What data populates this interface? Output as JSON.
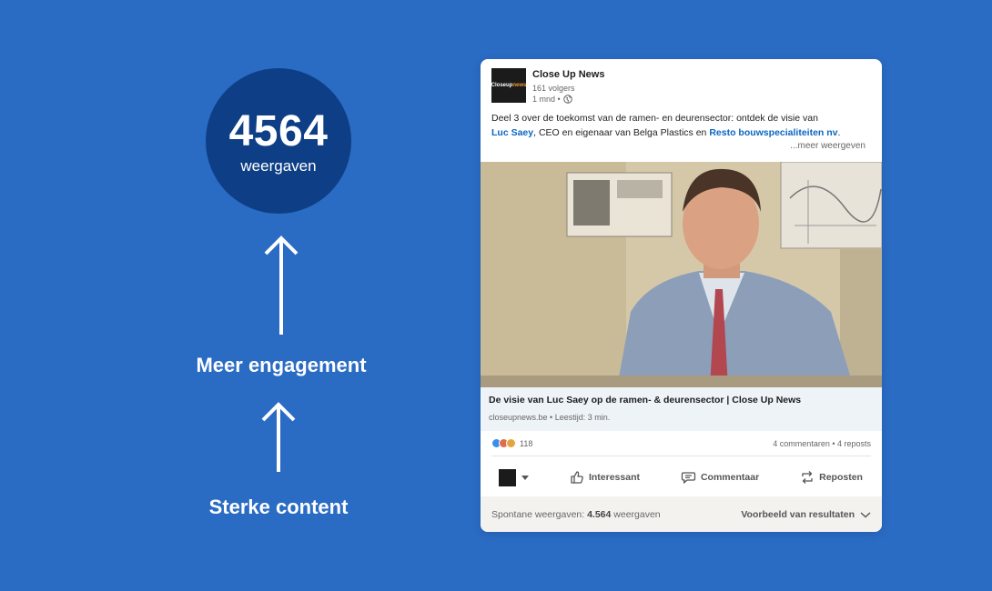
{
  "infographic": {
    "views_number": "4564",
    "views_label": "weergaven",
    "step_top": "Meer engagement",
    "step_bottom": "Sterke content"
  },
  "post": {
    "company": {
      "name": "Close Up News",
      "followers": "161 volgers",
      "time": "1 mnd •",
      "logo_text_white": "Closeup",
      "logo_text_orange": "news"
    },
    "text": {
      "part1": "Deel 3 over de toekomst van de ramen- en deurensector: ontdek de visie van",
      "mention1": "Luc Saey",
      "part2": ", CEO en eigenaar van Belga Plastics en ",
      "mention2": "Resto bouwspecialiteiten nv",
      "part3": ".",
      "more": "...meer weergeven"
    },
    "preview": {
      "title": "De visie van Luc Saey op de ramen- & deurensector | Close Up News",
      "meta": "closeupnews.be • Leestijd: 3 min."
    },
    "reactions": {
      "count": "118",
      "comments_reposts": "4 commentaren • 4 reposts"
    },
    "actions": {
      "interesting": "Interessant",
      "comment": "Commentaar",
      "repost": "Reposten"
    },
    "footer": {
      "views_prefix": "Spontane weergaven: ",
      "views_value": "4.564",
      "views_suffix": " weergaven",
      "preview_results": "Voorbeeld van resultaten"
    }
  },
  "colors": {
    "background": "#2a6bc4",
    "circle": "#0e3f86",
    "link": "#0a66c2"
  }
}
